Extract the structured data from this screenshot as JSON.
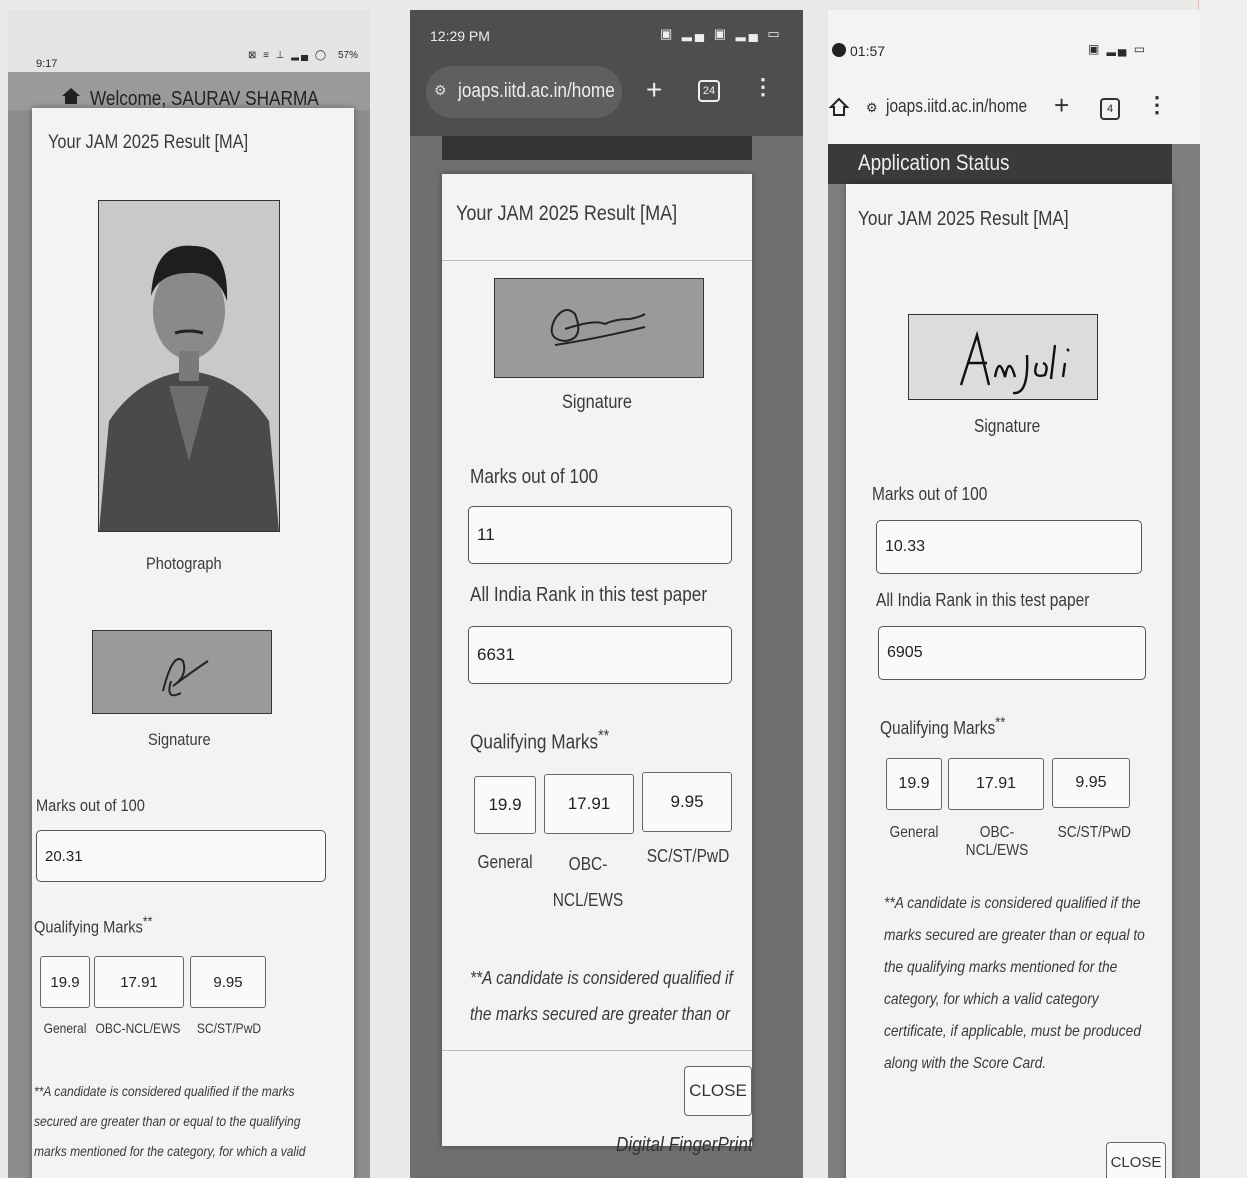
{
  "screenshot1": {
    "status_time": "9:17",
    "status_battery": "57%",
    "welcome": "Welcome, SAURAV SHARMA",
    "title": "Your JAM 2025 Result [MA]",
    "photo_label": "Photograph",
    "signature_label": "Signature",
    "marks_label": "Marks out of 100",
    "marks_value": "20.31",
    "qualifying_label": "Qualifying Marks",
    "qualifying_mark": "**",
    "qualifying": [
      {
        "value": "19.9",
        "category": "General"
      },
      {
        "value": "17.91",
        "category": "OBC-NCL/EWS"
      },
      {
        "value": "9.95",
        "category": "SC/ST/PwD"
      }
    ],
    "note_lines": [
      "**A candidate is considered qualified if the marks",
      "secured are greater than or equal to the qualifying",
      "marks mentioned for the category, for which a valid"
    ]
  },
  "screenshot2": {
    "status_time": "12:29 PM",
    "url": "joaps.iitd.ac.in/home",
    "tab_count": "24",
    "title": "Your JAM 2025 Result [MA]",
    "signature_label": "Signature",
    "marks_label": "Marks out of 100",
    "marks_value": "11",
    "rank_label": "All India Rank in this test paper",
    "rank_value": "6631",
    "qualifying_label": "Qualifying Marks",
    "qualifying_mark": "**",
    "qualifying": [
      {
        "value": "19.9",
        "category": "General"
      },
      {
        "value": "17.91",
        "category_line1": "OBC-",
        "category_line2": "NCL/EWS"
      },
      {
        "value": "9.95",
        "category": "SC/ST/PwD"
      }
    ],
    "note_lines": [
      "**A candidate is considered qualified if",
      "the marks secured are greater than or"
    ],
    "close_label": "CLOSE",
    "footer_text": "Digital FingerPrint"
  },
  "screenshot3": {
    "status_time": "01:57",
    "url": "joaps.iitd.ac.in/home",
    "tab_count": "4",
    "header": "Application Status",
    "title": "Your JAM 2025 Result [MA]",
    "signature_label": "Signature",
    "marks_label": "Marks out of 100",
    "marks_value": "10.33",
    "rank_label": "All India Rank in this test paper",
    "rank_value": "6905",
    "qualifying_label": "Qualifying Marks",
    "qualifying_mark": "**",
    "qualifying": [
      {
        "value": "19.9",
        "category": "General"
      },
      {
        "value": "17.91",
        "category": "OBC-NCL/EWS"
      },
      {
        "value": "9.95",
        "category": "SC/ST/PwD"
      }
    ],
    "note_lines": [
      "**A candidate is considered qualified if the",
      "marks secured are greater than or equal to",
      "the qualifying marks mentioned for the",
      "category, for which a valid category",
      "certificate, if applicable, must be produced",
      "along with the Score Card."
    ],
    "close_label": "CLOSE"
  }
}
